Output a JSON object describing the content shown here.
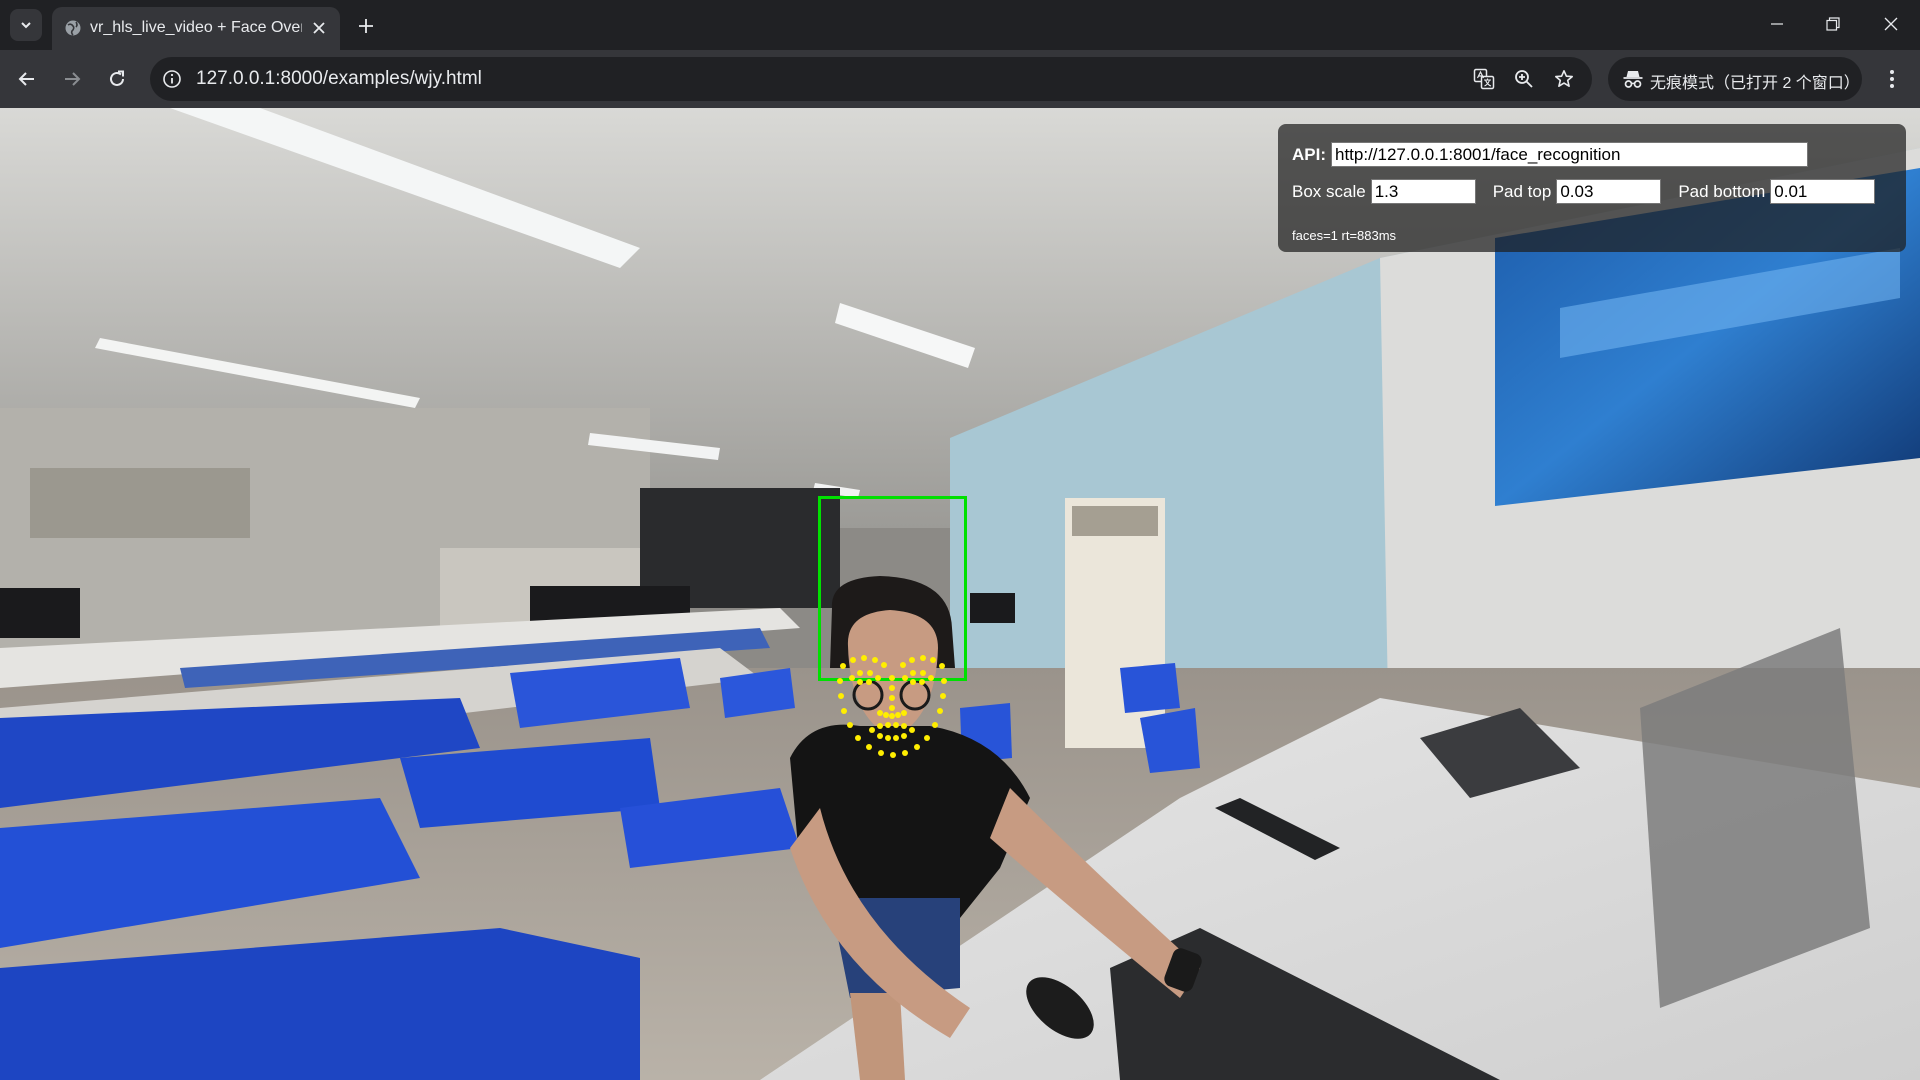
{
  "browser": {
    "tab": {
      "title": "vr_hls_live_video + Face Over"
    },
    "omnibox": {
      "url": "127.0.0.1:8000/examples/wjy.html"
    },
    "incognito": {
      "label": "无痕模式（已打开 2 个窗口）"
    },
    "icons": {
      "tab_search": "chevron-down-icon",
      "tab_close": "close-icon",
      "new_tab": "plus-icon",
      "back": "arrow-left-icon",
      "forward": "arrow-right-icon",
      "reload": "reload-icon",
      "site_info": "info-icon",
      "translate": "translate-icon",
      "zoom": "zoom-icon",
      "bookmark": "star-icon",
      "incognito": "incognito-icon",
      "menu": "more-vertical-icon",
      "minimize": "minimize-icon",
      "restore": "restore-icon",
      "close_window": "close-icon"
    }
  },
  "panel": {
    "api_label": "API:",
    "api_value": "http://127.0.0.1:8001/face_recognition",
    "box_scale_label": "Box scale",
    "box_scale_value": "1.3",
    "pad_top_label": "Pad top",
    "pad_top_value": "0.03",
    "pad_bottom_label": "Pad bottom",
    "pad_bottom_value": "0.01",
    "status": "faces=1 rt=883ms"
  },
  "overlay": {
    "box_color": "#00e000",
    "landmark_color": "#ffee00"
  }
}
